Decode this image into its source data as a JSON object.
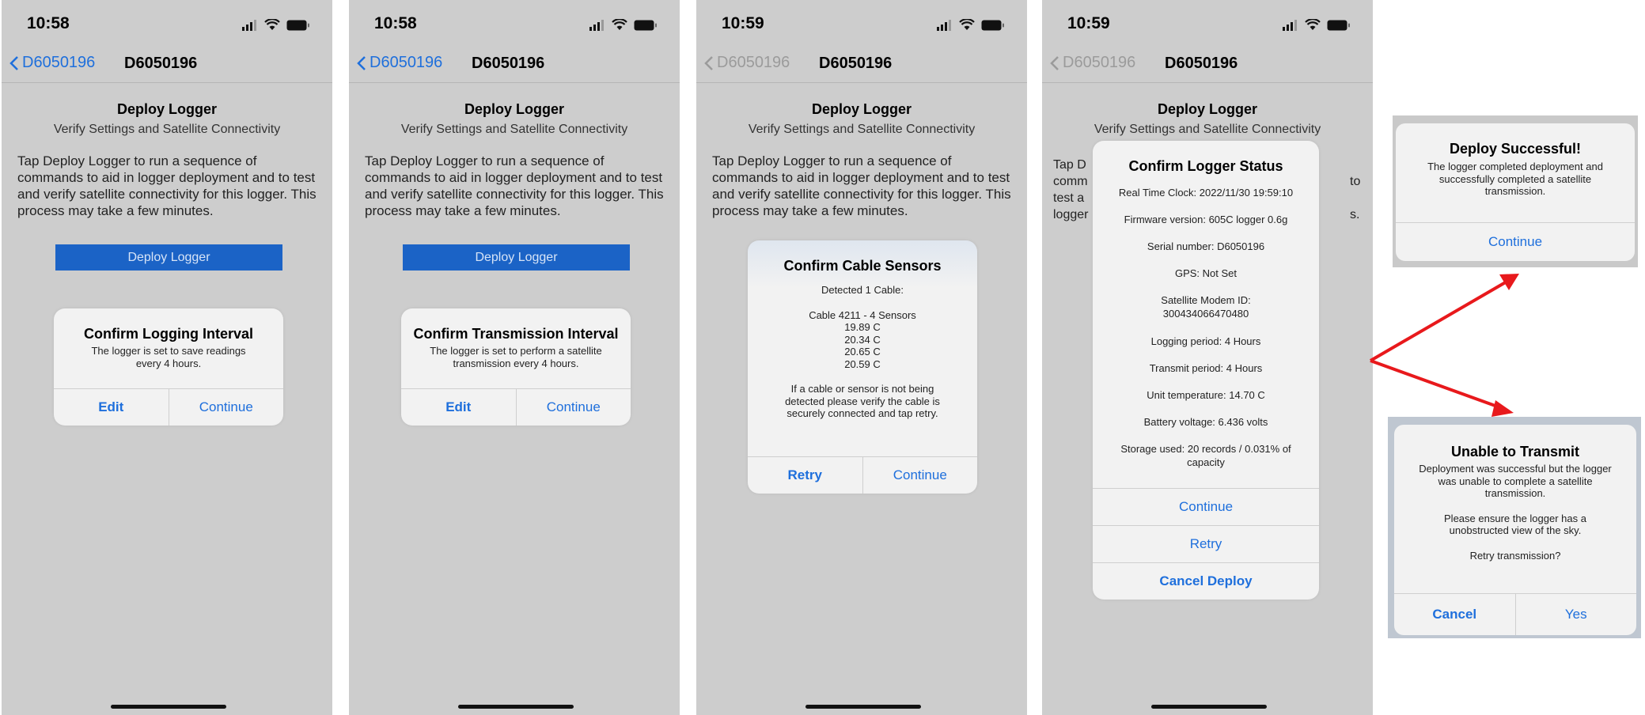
{
  "phones": [
    {
      "time": "10:58",
      "back": "D6050196",
      "title": "D6050196",
      "heading": "Deploy Logger",
      "subheading": "Verify Settings and Satellite Connectivity",
      "body": "Tap Deploy Logger to run a sequence of commands to aid in logger deployment and to test and verify satellite connectivity for this logger. This process may take a few minutes.",
      "button": "Deploy Logger",
      "alert": {
        "title": "Confirm Logging Interval",
        "message": "The logger is set to save readings every 4 hours.",
        "left": "Edit",
        "right": "Continue"
      }
    },
    {
      "time": "10:58",
      "back": "D6050196",
      "title": "D6050196",
      "heading": "Deploy Logger",
      "subheading": "Verify Settings and Satellite Connectivity",
      "body": "Tap Deploy Logger to run a sequence of commands to aid in logger deployment and to test and verify satellite connectivity for this logger. This process may take a few minutes.",
      "button": "Deploy Logger",
      "alert": {
        "title": "Confirm Transmission Interval",
        "message": "The logger is set to perform a satellite transmission every 4 hours.",
        "left": "Edit",
        "right": "Continue"
      }
    },
    {
      "time": "10:59",
      "back": "D6050196",
      "title": "D6050196",
      "heading": "Deploy Logger",
      "subheading": "Verify Settings and Satellite Connectivity",
      "body": "Tap Deploy Logger to run a sequence of commands to aid in logger deployment and to test and verify satellite connectivity for this logger. This process may take a few minutes.",
      "alert": {
        "title": "Confirm Cable Sensors",
        "detected": "Detected 1 Cable:",
        "cable": "Cable 4211 - 4 Sensors",
        "readings": [
          "19.89 C",
          "20.34 C",
          "20.65 C",
          "20.59 C"
        ],
        "note": "If a cable or sensor is not being detected please verify the cable is securely connected and tap retry.",
        "left": "Retry",
        "right": "Continue"
      }
    },
    {
      "time": "10:59",
      "back": "D6050196",
      "title": "D6050196",
      "heading": "Deploy Logger",
      "subheading": "Verify Settings and Satellite Connectivity",
      "body_fragments": [
        "Tap D",
        "comm",
        "test a",
        "logger",
        "to",
        "s."
      ],
      "alert": {
        "title": "Confirm Logger Status",
        "rows": [
          "Real Time Clock: 2022/11/30 19:59:10",
          "Firmware version: 605C logger 0.6g",
          "Serial number: D6050196",
          "GPS: Not Set",
          "Satellite Modem ID: 300434066470480",
          "Logging period: 4 Hours",
          "Transmit period: 4 Hours",
          "Unit temperature: 14.70 C",
          "Battery voltage: 6.436 volts",
          "Storage used: 20 records / 0.031% of capacity"
        ],
        "buttons": [
          "Continue",
          "Retry",
          "Cancel Deploy"
        ]
      }
    }
  ],
  "success": {
    "title": "Deploy Successful!",
    "message": "The logger completed deployment and successfully completed a satellite transmission.",
    "button": "Continue"
  },
  "failure": {
    "title": "Unable to Transmit",
    "message": "Deployment was successful but the logger was unable to complete a satellite transmission.",
    "message2": "Please ensure the logger has a unobstructed view of the sky.",
    "message3": "Retry transmission?",
    "left": "Cancel",
    "right": "Yes"
  },
  "colors": {
    "accent": "#1e6fdc",
    "deploy_button": "#1b63c6",
    "arrow": "#e8191c",
    "screen_bg": "#cdcdcd"
  }
}
